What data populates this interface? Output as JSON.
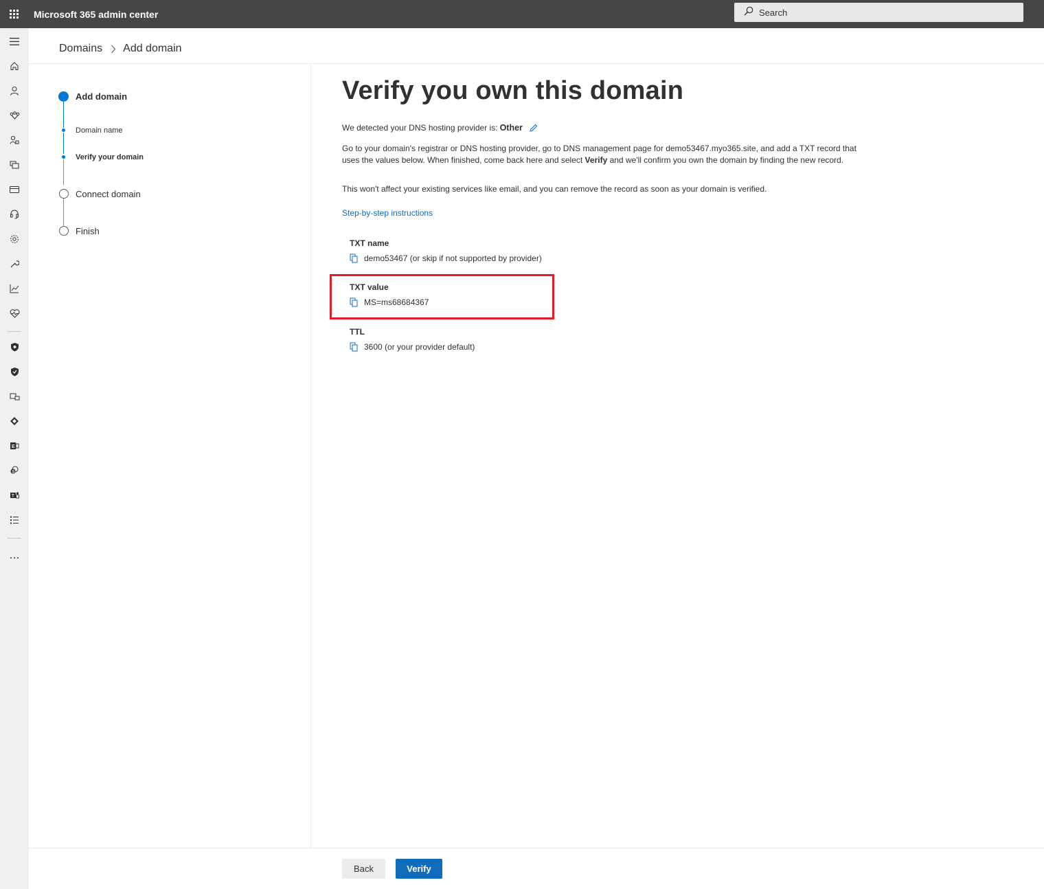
{
  "app": {
    "title": "Microsoft 365 admin center"
  },
  "search": {
    "placeholder": "Search"
  },
  "breadcrumb": {
    "parent": "Domains",
    "current": "Add domain"
  },
  "steps": [
    {
      "label": "Add domain",
      "state": "active"
    },
    {
      "label": "Domain name",
      "state": "done"
    },
    {
      "label": "Verify your domain",
      "state": "current"
    },
    {
      "label": "Connect domain",
      "state": "pending"
    },
    {
      "label": "Finish",
      "state": "pending"
    }
  ],
  "main": {
    "title": "Verify you own this domain",
    "detected_prefix": "We detected your DNS hosting provider is:",
    "detected_value": "Other",
    "instruction_part1": "Go to your domain's registrar or DNS hosting provider, go to DNS management page for demo53467.myo365.site, and add a TXT record that uses the values below. When finished, come back here and select ",
    "instruction_bold": "Verify",
    "instruction_part2": " and we'll confirm you own the domain by finding the new record.",
    "note": "This won't affect your existing services like email, and you can remove the record as soon as your domain is verified.",
    "link": "Step-by-step instructions"
  },
  "records": {
    "txt_name": {
      "label": "TXT name",
      "value": "demo53467 (or skip if not supported by provider)"
    },
    "txt_value": {
      "label": "TXT value",
      "value": "MS=ms68684367"
    },
    "ttl": {
      "label": "TTL",
      "value": "3600 (or your provider default)"
    }
  },
  "footer": {
    "back": "Back",
    "verify": "Verify"
  },
  "colors": {
    "topbar": "#464646",
    "accent": "#0078d4",
    "primary_button": "#0f6cbd",
    "highlight": "#e11d2a"
  }
}
